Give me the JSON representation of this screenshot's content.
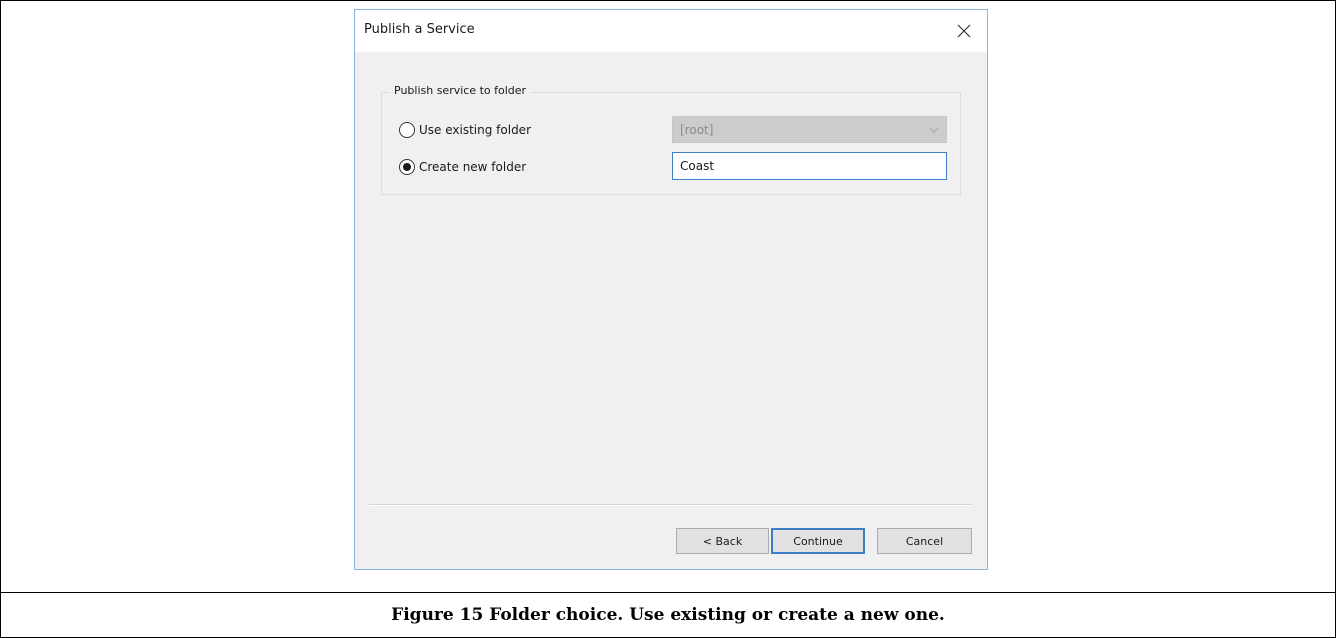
{
  "dialog": {
    "title": "Publish a Service",
    "group_label": "Publish service to folder",
    "options": [
      {
        "label": "Use existing folder",
        "checked": false
      },
      {
        "label": "Create new folder",
        "checked": true
      }
    ],
    "existing_folder_value": "[root]",
    "new_folder_value": "Coast",
    "buttons": {
      "back": "< Back",
      "continue": "Continue",
      "cancel": "Cancel"
    }
  },
  "caption": "Figure 15 Folder choice.  Use existing or create a new one.",
  "colors": {
    "accent": "#3c7fc6",
    "dialog_background": "#f0f0f0",
    "disabled_select": "#cccccc"
  }
}
